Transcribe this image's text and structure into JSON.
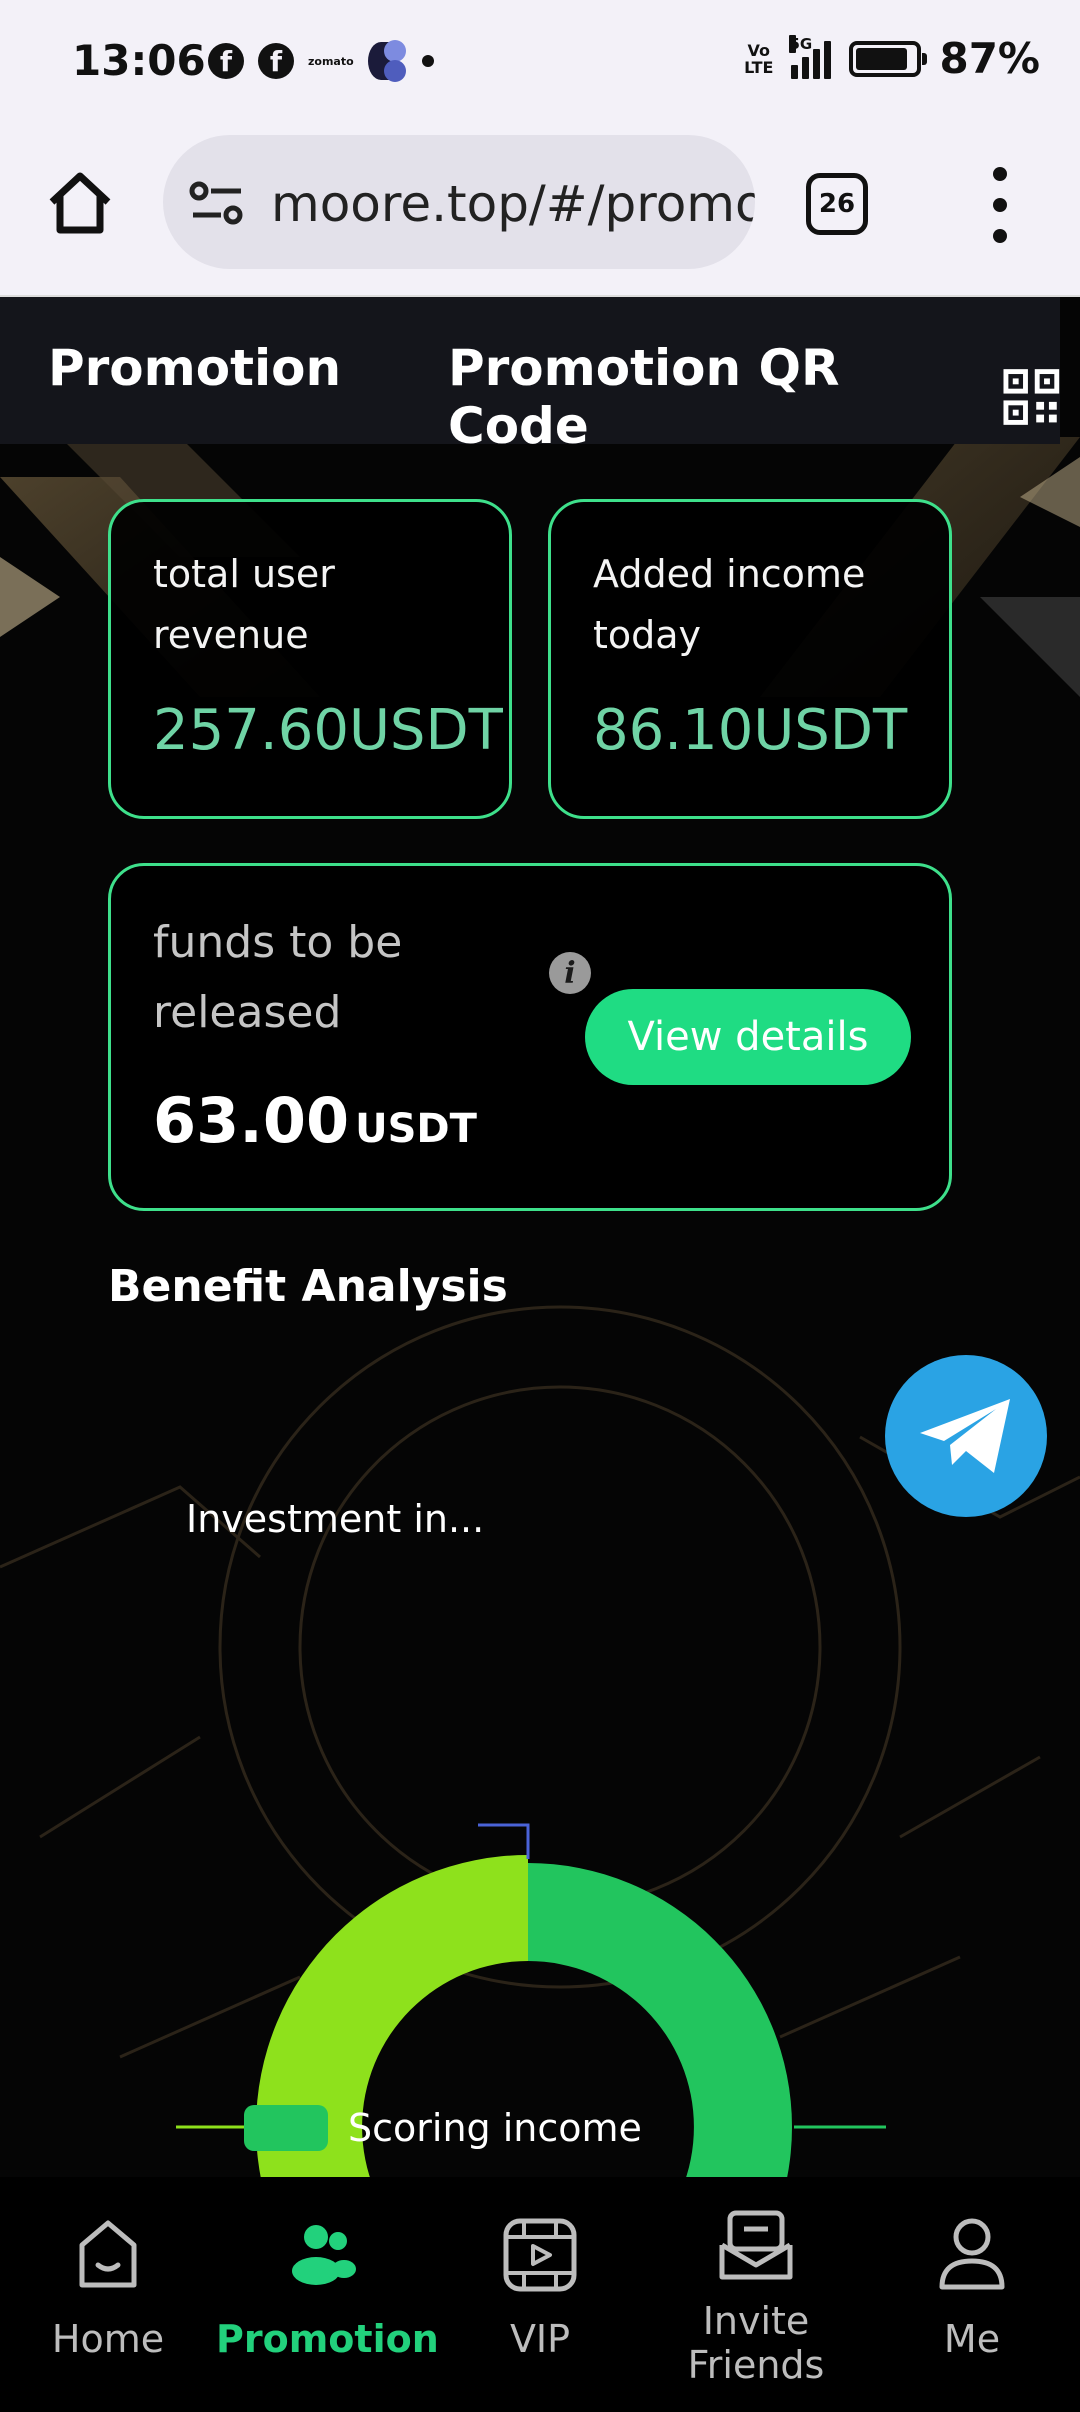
{
  "status_bar": {
    "time": "13:06",
    "fb_glyph": "f",
    "zomato_text": "zomato",
    "volte_line1": "Vo",
    "volte_line2": "LTE",
    "network": "5G",
    "battery": "87%",
    "battery_level": 0.87
  },
  "browser": {
    "url": "moore.top/#/promotion",
    "tab_count": "26"
  },
  "header": {
    "title": "Promotion",
    "qr_label": "Promotion QR Code"
  },
  "stats": {
    "total_label": "total user revenue",
    "total_value": "257.60USDT",
    "today_label": "Added income today",
    "today_value": "86.10USDT"
  },
  "funds": {
    "label": "funds to be released",
    "value": "63.00",
    "unit": "USDT",
    "info_glyph": "i",
    "button": "View details"
  },
  "analysis": {
    "title": "Benefit Analysis",
    "chart_label": "Investment in...",
    "legend": "Scoring income"
  },
  "chart_data": {
    "type": "pie",
    "series": [
      {
        "name": "Investment in...",
        "value": 50,
        "color": "#8ee11c"
      },
      {
        "name": "Scoring income",
        "value": 50,
        "color": "#22c55e"
      }
    ]
  },
  "nav": {
    "items": [
      {
        "label": "Home",
        "icon": "home-icon"
      },
      {
        "label": "Promotion",
        "icon": "users-icon"
      },
      {
        "label": "VIP",
        "icon": "video-icon"
      },
      {
        "label": "Invite Friends",
        "icon": "mail-icon"
      },
      {
        "label": "Me",
        "icon": "person-icon"
      }
    ]
  },
  "colors": {
    "accent": "#22d17c",
    "card_border": "#3ee08b",
    "value_text": "#6fd3a5",
    "telegram": "#2aa3e4"
  }
}
